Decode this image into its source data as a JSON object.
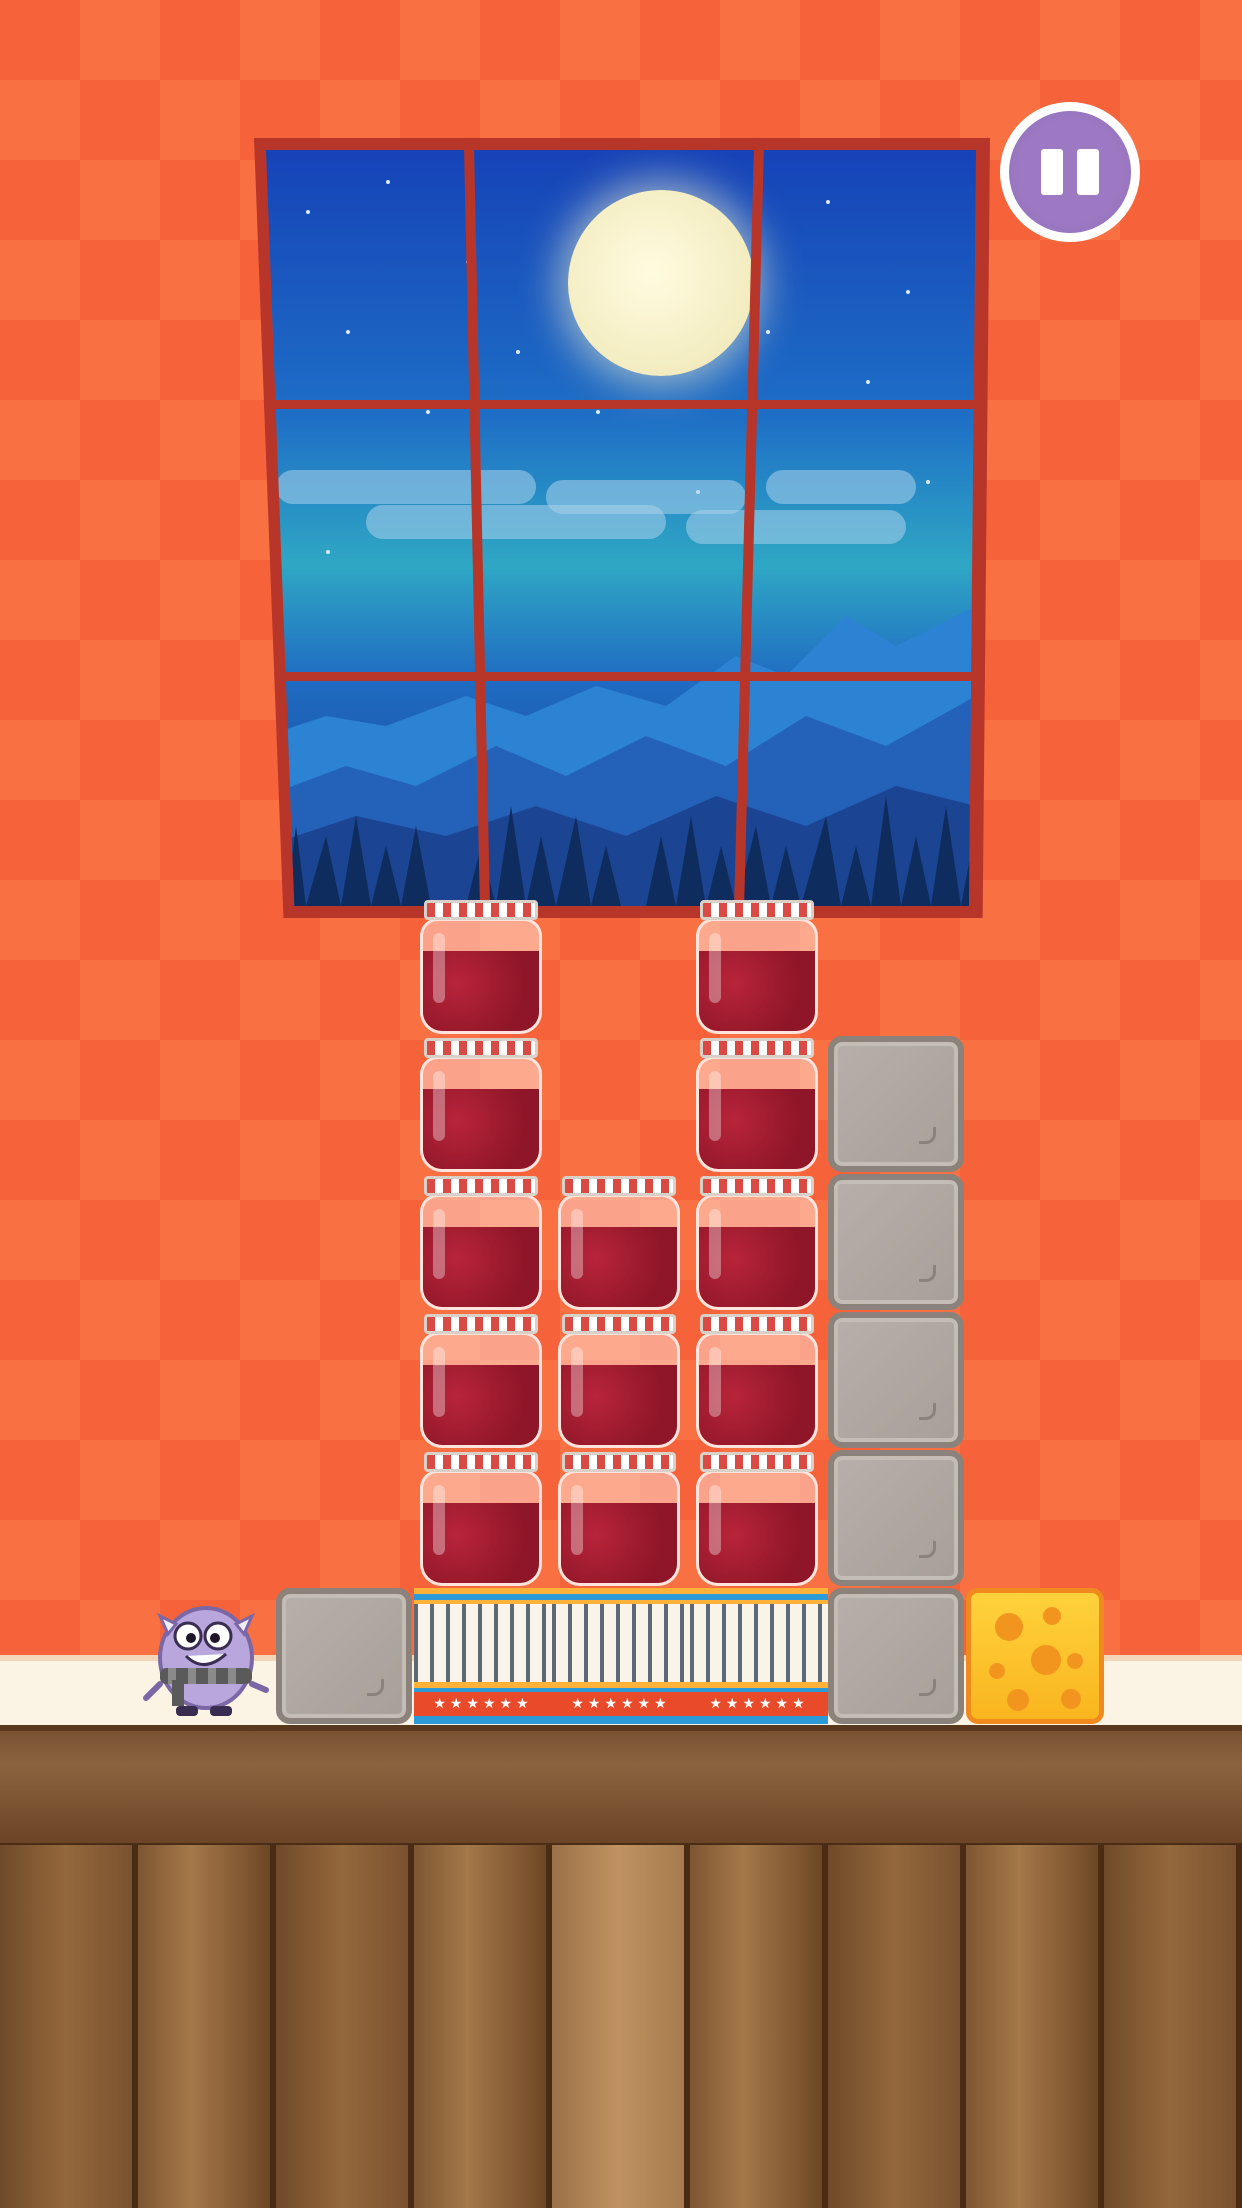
{
  "game": {
    "scene": "night-window-room",
    "pause_button": {
      "icon": "pause-icon"
    },
    "character": {
      "icon": "purple-monster-icon"
    },
    "goal": {
      "icon": "cheese-icon"
    },
    "colors": {
      "wall": "#f6623a",
      "jam": "#8f1628",
      "stone": "#a79f98",
      "cheese": "#ffd23c",
      "pause_button": "#9c79c2",
      "sky": "#1643b8"
    },
    "crate_label": "★★★★★★",
    "grid": {
      "columns": 6,
      "rows": 6,
      "cells": [
        [
          "empty",
          "empty",
          "jam",
          "empty",
          "jam",
          "empty"
        ],
        [
          "empty",
          "empty",
          "jam",
          "empty",
          "jam",
          "stone"
        ],
        [
          "empty",
          "empty",
          "jam",
          "jam",
          "jam",
          "stone"
        ],
        [
          "empty",
          "empty",
          "jam",
          "jam",
          "jam",
          "stone"
        ],
        [
          "empty",
          "empty",
          "jam",
          "jam",
          "jam",
          "stone"
        ],
        [
          "monster",
          "stone",
          "crate",
          "crate",
          "crate",
          "stone",
          "cheese"
        ]
      ]
    }
  }
}
